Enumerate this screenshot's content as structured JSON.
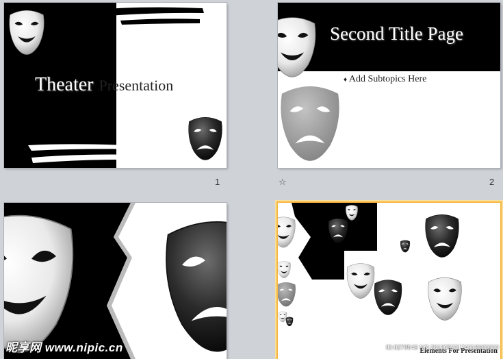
{
  "slides": [
    {
      "number": "1",
      "title_part1": "Theater",
      "title_part2": "Presentation"
    },
    {
      "number": "2",
      "title": "Second Title Page",
      "subtitle": "Add Subtopics Here",
      "transition_icon": "star-icon"
    },
    {
      "number": "",
      "title": ""
    },
    {
      "number": "",
      "caption": "Elements For Presentation",
      "selected": true
    }
  ],
  "watermark": {
    "left": "昵享网 www.nipic.cn",
    "right": "ID:8279543 NO:20130520174319600000"
  },
  "colors": {
    "background": "#cfd3d8",
    "selection": "#f4b840",
    "black": "#000000",
    "white": "#ffffff"
  }
}
